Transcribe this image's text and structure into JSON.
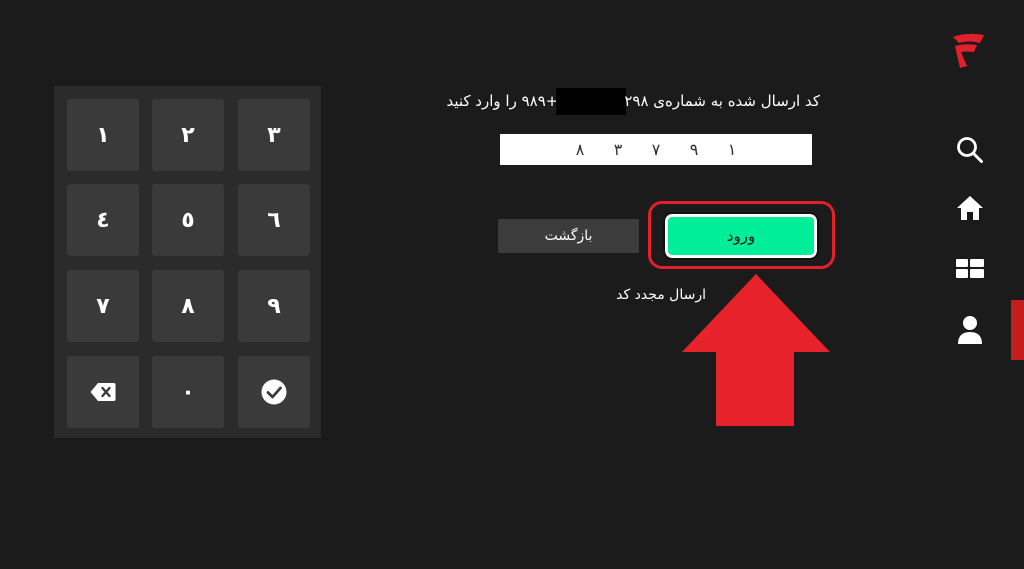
{
  "keypad": {
    "keys": [
      "١",
      "٢",
      "٣",
      "٤",
      "٥",
      "٦",
      "٧",
      "٨",
      "٩",
      "backspace-icon",
      "٠",
      "check-icon"
    ]
  },
  "login": {
    "instruction_prefix": "کد ارسال شده به شماره‌ی ۲۹۸",
    "instruction_suffix": "+۹۸۹ را وارد کنید",
    "code_digits": [
      "١",
      "٩",
      "٧",
      "٣",
      "٨"
    ],
    "back_label": "بازگشت",
    "submit_label": "ورود",
    "resend_label": "ارسال مجدد کد"
  },
  "colors": {
    "background": "#1b1b1b",
    "accent": "#00ee9a",
    "highlight": "#e2202b",
    "brand": "#e2202b"
  },
  "sidebar": {
    "items": [
      "search-icon",
      "home-icon",
      "categories-icon",
      "user-icon"
    ],
    "active": "user-icon"
  }
}
